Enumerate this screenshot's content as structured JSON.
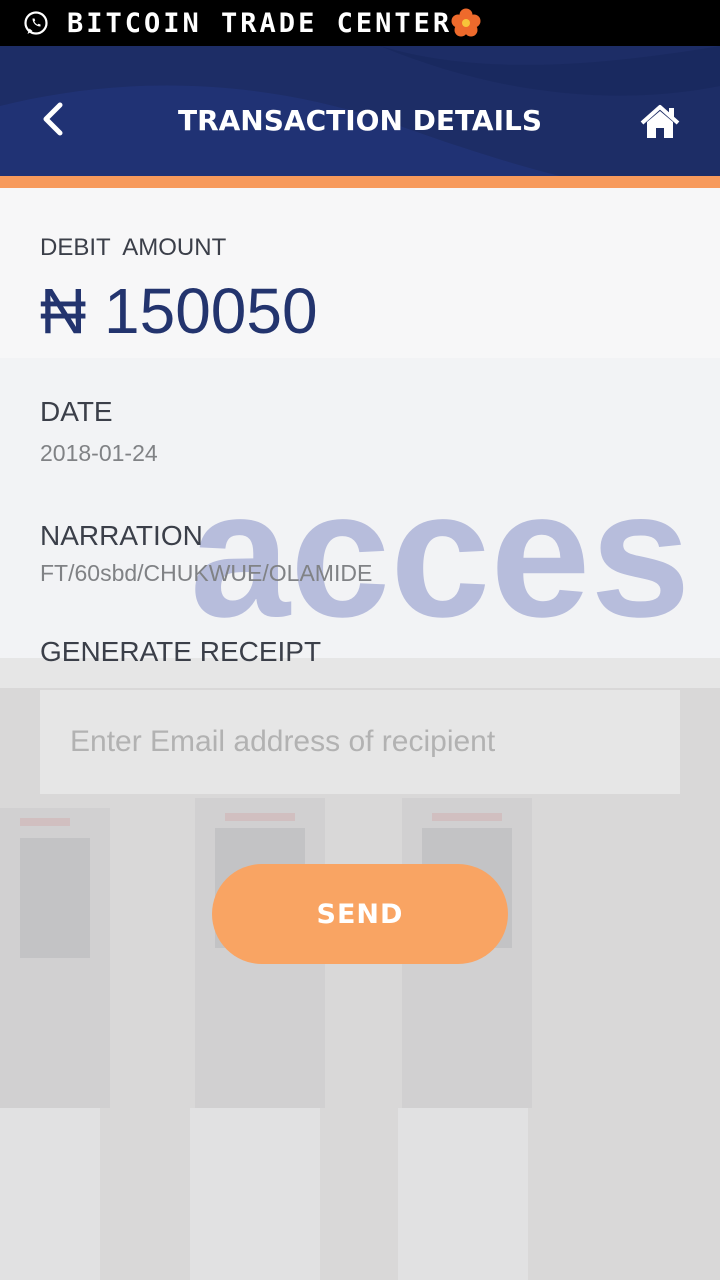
{
  "status_bar": {
    "watermark": "BITCOIN TRADE CENTER",
    "icons": [
      "whatsapp-icon",
      "flower-emoji-icon"
    ]
  },
  "header": {
    "title": "TRANSACTION DETAILS",
    "back_icon": "chevron-left-icon",
    "home_icon": "home-icon"
  },
  "details": {
    "debit_amount_label": "DEBIT  AMOUNT",
    "debit_amount_value": "₦ 150050",
    "date_label": "DATE",
    "date_value": "2018-01-24",
    "narration_label": "NARRATION",
    "narration_value": "FT/60sbd/CHUKWUE/OLAMIDE"
  },
  "receipt": {
    "label": "GENERATE RECEIPT",
    "email_placeholder": "Enter Email address of recipient",
    "email_value": "",
    "send_label": "SEND"
  },
  "background": {
    "sign_text": "acces"
  },
  "colors": {
    "header": "#1d2d66",
    "accent": "#f79a5c",
    "send_button": "#f9a463",
    "amount": "#23346e"
  }
}
